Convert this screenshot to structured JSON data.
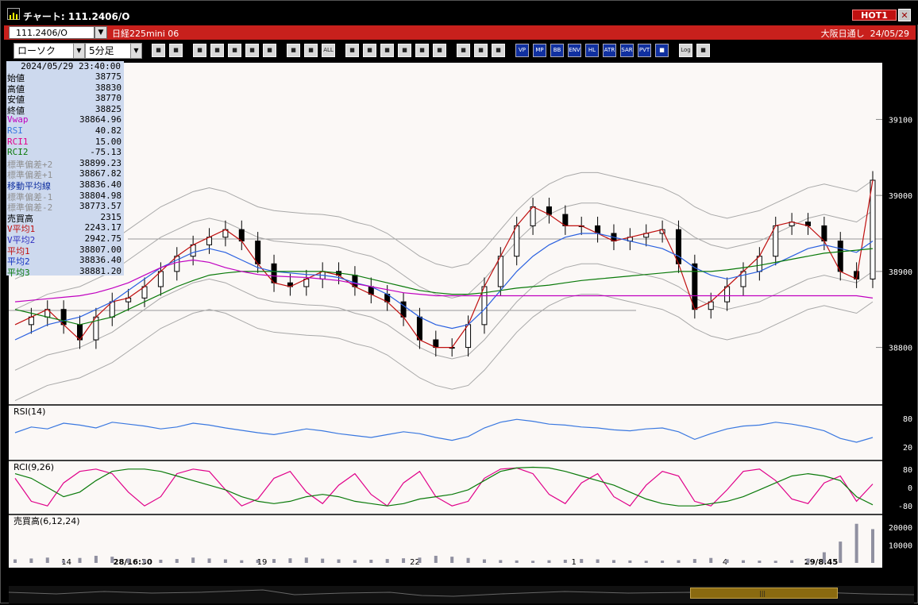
{
  "window": {
    "title": "チャート: 111.2406/O",
    "hot_label": "HOT1",
    "close_label": "✕"
  },
  "symbol_bar": {
    "symbol": "111.2406/O",
    "name": "日経225mini 06",
    "session": "大阪日通し",
    "date": "24/05/29"
  },
  "toolbar": {
    "chart_type": "ローソク",
    "interval": "5分足",
    "buttons": [
      "zoom-in",
      "layout",
      "marker",
      "zoom-box",
      "crosshair",
      "grid",
      "disabled",
      "candle",
      "bar",
      "all",
      "line",
      "draw",
      "cursor",
      "arrow",
      "note",
      "trash",
      "pattern",
      "tool",
      "palette",
      "volume-profile",
      "market-profile",
      "bollinger",
      "moving-average-env",
      "high-low",
      "atr",
      "parabolic",
      "pivot",
      "box",
      "log",
      "export"
    ],
    "button_labels": {
      "all": "ALL",
      "volume_profile": "VP",
      "market_profile": "MP",
      "bb": "BB",
      "env": "ENV",
      "hl": "HL",
      "atr": "ATR",
      "sar": "SAR",
      "pvt": "PVT",
      "log": "Log"
    }
  },
  "info": {
    "datetime": "2024/05/29  23:40:00",
    "rows": [
      {
        "label": "始値",
        "value": "38775",
        "color": "#000000"
      },
      {
        "label": "高値",
        "value": "38830",
        "color": "#000000"
      },
      {
        "label": "安値",
        "value": "38770",
        "color": "#000000"
      },
      {
        "label": "終値",
        "value": "38825",
        "color": "#000000"
      },
      {
        "label": "Vwap",
        "value": "38864.96",
        "color": "#c000c0"
      },
      {
        "label": "RSI",
        "value": "40.82",
        "color": "#3a78e0"
      },
      {
        "label": "RCI1",
        "value": "15.00",
        "color": "#e0008a"
      },
      {
        "label": "RCI2",
        "value": "-75.13",
        "color": "#0a7a0a"
      },
      {
        "label": "標準偏差+2",
        "value": "38899.23",
        "color": "#909090"
      },
      {
        "label": "標準偏差+1",
        "value": "38867.82",
        "color": "#909090"
      },
      {
        "label": "移動平均線",
        "value": "38836.40",
        "color": "#1030a0"
      },
      {
        "label": "標準偏差-1",
        "value": "38804.98",
        "color": "#909090"
      },
      {
        "label": "標準偏差-2",
        "value": "38773.57",
        "color": "#909090"
      },
      {
        "label": "売買高",
        "value": "2315",
        "color": "#000000"
      },
      {
        "label": "V平均1",
        "value": "2243.17",
        "color": "#c01010"
      },
      {
        "label": "V平均2",
        "value": "2942.75",
        "color": "#3030c0"
      },
      {
        "label": "平均1",
        "value": "38807.00",
        "color": "#c01010"
      },
      {
        "label": "平均2",
        "value": "38836.40",
        "color": "#1030c0"
      },
      {
        "label": "平均3",
        "value": "38881.20",
        "color": "#0a7a0a"
      }
    ]
  },
  "panes": {
    "rsi_label": "RSI(14)",
    "rci_label": "RCI(9,26)",
    "volume_label": "売買高(6,12,24)"
  },
  "chart_data": [
    {
      "type": "line",
      "title": "",
      "y_ticks": [
        38800,
        38900,
        39000,
        39100
      ],
      "ylim": [
        38740,
        39160
      ],
      "x_tick_labels": [
        "14",
        "28/16:30",
        "19",
        "22",
        "1",
        "4",
        "29/8:45"
      ],
      "x_tick_positions": [
        0.066,
        0.142,
        0.29,
        0.465,
        0.647,
        0.82,
        0.93
      ],
      "series": [
        {
          "name": "平均1",
          "color": "#c01010",
          "values": [
            38830,
            38840,
            38850,
            38830,
            38810,
            38840,
            38860,
            38865,
            38880,
            38900,
            38920,
            38935,
            38945,
            38955,
            38940,
            38910,
            38885,
            38880,
            38890,
            38900,
            38895,
            38880,
            38870,
            38860,
            38840,
            38810,
            38800,
            38800,
            38830,
            38880,
            38920,
            38960,
            38985,
            38975,
            38960,
            38960,
            38950,
            38940,
            38945,
            38950,
            38955,
            38910,
            38850,
            38860,
            38880,
            38900,
            38920,
            38960,
            38965,
            38960,
            38940,
            38900,
            38890,
            39020
          ]
        },
        {
          "name": "平均2",
          "color": "#2a60e0",
          "values": [
            38810,
            38820,
            38830,
            38835,
            38840,
            38850,
            38860,
            38875,
            38890,
            38905,
            38915,
            38925,
            38930,
            38925,
            38915,
            38905,
            38900,
            38898,
            38896,
            38895,
            38892,
            38885,
            38880,
            38870,
            38855,
            38840,
            38830,
            38825,
            38830,
            38850,
            38875,
            38900,
            38920,
            38935,
            38945,
            38950,
            38950,
            38945,
            38940,
            38935,
            38930,
            38920,
            38905,
            38895,
            38890,
            38895,
            38900,
            38910,
            38920,
            38930,
            38935,
            38930,
            38925,
            38940
          ]
        },
        {
          "name": "平均3",
          "color": "#0a7a0a",
          "values": [
            38850,
            38845,
            38840,
            38835,
            38830,
            38835,
            38840,
            38850,
            38860,
            38870,
            38880,
            38888,
            38895,
            38898,
            38900,
            38900,
            38900,
            38900,
            38900,
            38900,
            38898,
            38895,
            38890,
            38885,
            38880,
            38875,
            38872,
            38870,
            38870,
            38872,
            38875,
            38878,
            38880,
            38882,
            38885,
            38888,
            38890,
            38892,
            38894,
            38896,
            38898,
            38900,
            38900,
            38900,
            38902,
            38905,
            38908,
            38912,
            38916,
            38920,
            38924,
            38926,
            38928,
            38930
          ]
        },
        {
          "name": "Vwap",
          "color": "#c000c0",
          "values": [
            38860,
            38862,
            38864,
            38866,
            38868,
            38872,
            38878,
            38885,
            38895,
            38905,
            38912,
            38915,
            38912,
            38905,
            38900,
            38896,
            38894,
            38893,
            38892,
            38890,
            38888,
            38884,
            38880,
            38876,
            38872,
            38870,
            38868,
            38868,
            38868,
            38868,
            38868,
            38868,
            38868,
            38868,
            38868,
            38868,
            38868,
            38868,
            38868,
            38868,
            38868,
            38868,
            38868,
            38868,
            38868,
            38868,
            38868,
            38868,
            38868,
            38868,
            38868,
            38868,
            38868,
            38865
          ]
        }
      ]
    },
    {
      "type": "line",
      "title": "",
      "y_ticks": [
        20,
        80
      ],
      "ylim": [
        0,
        100
      ],
      "series": [
        {
          "name": "RSI",
          "color": "#3a78e0",
          "values": [
            50,
            62,
            58,
            70,
            66,
            60,
            72,
            68,
            64,
            58,
            62,
            70,
            66,
            60,
            55,
            50,
            46,
            52,
            58,
            54,
            48,
            44,
            40,
            46,
            52,
            48,
            40,
            34,
            42,
            60,
            72,
            78,
            74,
            68,
            66,
            62,
            60,
            56,
            54,
            58,
            60,
            52,
            36,
            48,
            58,
            64,
            66,
            72,
            68,
            62,
            54,
            38,
            30,
            40
          ]
        }
      ]
    },
    {
      "type": "line",
      "title": "",
      "y_ticks": [
        -80,
        0,
        80
      ],
      "ylim": [
        -100,
        100
      ],
      "series": [
        {
          "name": "RCI1",
          "color": "#e0008a",
          "values": [
            40,
            -60,
            -80,
            20,
            70,
            80,
            60,
            -20,
            -80,
            -40,
            60,
            80,
            70,
            -10,
            -80,
            -50,
            40,
            70,
            -20,
            -70,
            10,
            60,
            -30,
            -80,
            20,
            70,
            -40,
            -80,
            -60,
            40,
            80,
            85,
            60,
            -30,
            -70,
            20,
            60,
            -40,
            -80,
            10,
            70,
            50,
            -60,
            -80,
            -10,
            70,
            80,
            30,
            -50,
            -70,
            20,
            50,
            -60,
            15
          ]
        },
        {
          "name": "RCI2",
          "color": "#0a7a0a",
          "values": [
            60,
            40,
            0,
            -40,
            -20,
            30,
            70,
            80,
            80,
            70,
            50,
            30,
            10,
            -10,
            -40,
            -60,
            -70,
            -60,
            -40,
            -30,
            -40,
            -60,
            -70,
            -80,
            -70,
            -50,
            -40,
            -30,
            -10,
            30,
            70,
            85,
            88,
            85,
            70,
            50,
            30,
            10,
            -20,
            -50,
            -70,
            -80,
            -80,
            -70,
            -60,
            -40,
            -10,
            20,
            50,
            60,
            50,
            30,
            -40,
            -75
          ]
        }
      ]
    },
    {
      "type": "bar",
      "title": "",
      "y_ticks": [
        10000,
        20000
      ],
      "ylim": [
        0,
        25000
      ],
      "series": [
        {
          "name": "売買高",
          "color": "#9090a0",
          "values": [
            2000,
            2500,
            3000,
            1500,
            2800,
            4000,
            3500,
            2500,
            2000,
            1800,
            2200,
            3000,
            2500,
            2000,
            1500,
            1800,
            2200,
            2600,
            3000,
            2400,
            2000,
            1600,
            1800,
            2200,
            2600,
            3000,
            4000,
            3500,
            2800,
            2000,
            1600,
            1400,
            1200,
            1500,
            1800,
            2200,
            2000,
            1600,
            1400,
            1200,
            1300,
            1500,
            2200,
            2800,
            2000,
            1500,
            1300,
            1200,
            1500,
            2500,
            6000,
            12000,
            22000,
            19000
          ]
        }
      ]
    }
  ]
}
